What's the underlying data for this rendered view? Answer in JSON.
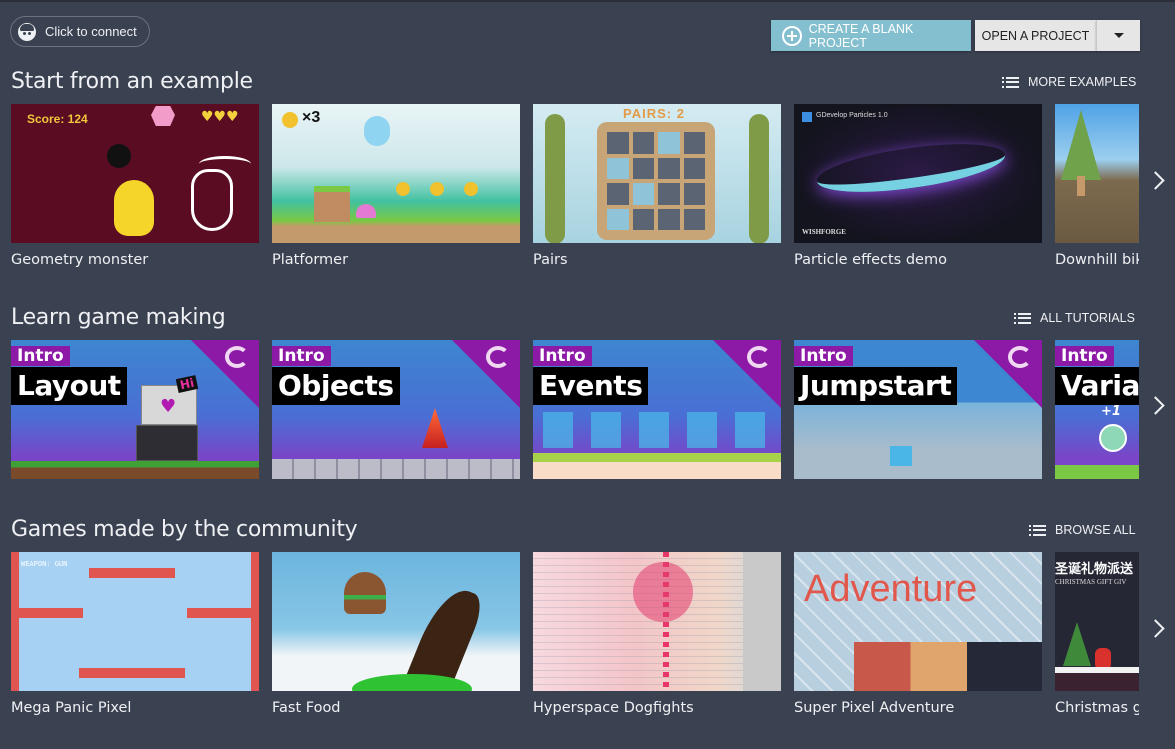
{
  "header": {
    "connect_label": "Click to connect",
    "create_label": "CREATE A BLANK PROJECT",
    "open_label": "OPEN A PROJECT",
    "create_color": "#84bfcf"
  },
  "sections": [
    {
      "title": "Start from an example",
      "link_label": "MORE EXAMPLES",
      "items": [
        {
          "title": "Geometry monster",
          "thumb_text": "Score: 124"
        },
        {
          "title": "Platformer",
          "thumb_text": "×3"
        },
        {
          "title": "Pairs",
          "thumb_text": "PAIRS: 2"
        },
        {
          "title": "Particle effects demo",
          "thumb_text": "GDevelop Particles 1.0",
          "thumb_text2": "WISHFORGE"
        },
        {
          "title": "Downhill bik"
        }
      ]
    },
    {
      "title": "Learn game making",
      "link_label": "ALL TUTORIALS",
      "items": [
        {
          "title": "Layout",
          "tag": "Intro",
          "badge": "Hi"
        },
        {
          "title": "Objects",
          "tag": "Intro"
        },
        {
          "title": "Events",
          "tag": "Intro"
        },
        {
          "title": "Jumpstart",
          "tag": "Intro"
        },
        {
          "title": "Variat",
          "tag": "Intro",
          "badge": "+1"
        }
      ]
    },
    {
      "title": "Games made by the community",
      "link_label": "BROWSE ALL",
      "items": [
        {
          "title": "Mega Panic Pixel",
          "thumb_text": "WEAPON: GUN"
        },
        {
          "title": "Fast Food"
        },
        {
          "title": "Hyperspace Dogfights"
        },
        {
          "title": "Super Pixel Adventure",
          "thumb_text": "Super Pixel Adventure"
        },
        {
          "title": "Christmas g",
          "thumb_text": "圣诞礼物派送",
          "thumb_text2": "CHRISTMAS GIFT GIV"
        }
      ]
    }
  ],
  "accent_color": "#8c1aa6"
}
